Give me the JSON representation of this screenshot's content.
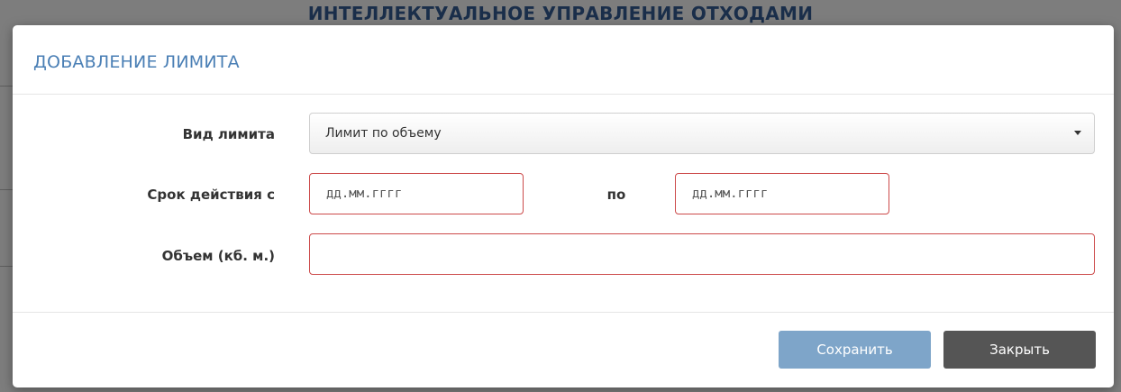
{
  "background": {
    "page_title": "ИНТЕЛЛЕКТУАЛЬНОЕ УПРАВЛЕНИЕ ОТХОДАМИ"
  },
  "modal": {
    "title": "ДОБАВЛЕНИЕ ЛИМИТА",
    "fields": {
      "limit_type": {
        "label": "Вид лимита",
        "value": "Лимит по объему"
      },
      "period": {
        "label": "Срок действия с",
        "from_placeholder": "дд.мм.гггг",
        "to_label": "по",
        "to_placeholder": "дд.мм.гггг"
      },
      "volume": {
        "label": "Объем (кб. м.)",
        "value": ""
      }
    },
    "buttons": {
      "save": "Сохранить",
      "close": "Закрыть"
    }
  },
  "colors": {
    "title_blue": "#4a7fb5",
    "error_border": "#cc4a4a",
    "save_button": "#7ea5c9",
    "close_button": "#555555"
  },
  "icons": [
    "chevron-down-icon"
  ]
}
